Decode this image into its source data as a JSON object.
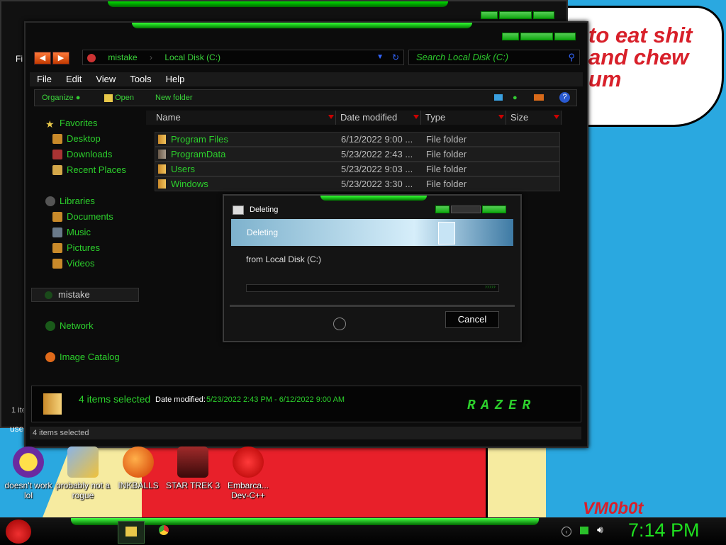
{
  "desktop": {
    "bubble_lines": [
      "to eat shit",
      "and chew",
      "um"
    ],
    "vm_label": "VM0b0t"
  },
  "back_window": {
    "menu_fragment": "Fi",
    "status_fragment": "1 ite",
    "desktop_fragment": "use"
  },
  "explorer": {
    "address": {
      "segments": [
        "mistake",
        "Local Disk (C:)"
      ]
    },
    "search": {
      "placeholder": "Search Local Disk (C:)"
    },
    "menu": [
      "File",
      "Edit",
      "View",
      "Tools",
      "Help"
    ],
    "toolbar": {
      "organize": "Organize",
      "open": "Open",
      "new_folder": "New folder"
    },
    "sidebar": {
      "favorites": "Favorites",
      "favorites_items": [
        "Desktop",
        "Downloads",
        "Recent Places"
      ],
      "libraries": "Libraries",
      "libraries_items": [
        "Documents",
        "Music",
        "Pictures",
        "Videos"
      ],
      "homegroup": "mistake",
      "network": "Network",
      "image_catalog": "Image Catalog"
    },
    "columns": [
      "Name",
      "Date modified",
      "Type",
      "Size"
    ],
    "files": [
      {
        "name": "Program Files",
        "date": "6/12/2022 9:00 ...",
        "type": "File folder"
      },
      {
        "name": "ProgramData",
        "date": "5/23/2022 2:43 ...",
        "type": "File folder"
      },
      {
        "name": "Users",
        "date": "5/23/2022 9:03 ...",
        "type": "File folder"
      },
      {
        "name": "Windows",
        "date": "5/23/2022 3:30 ...",
        "type": "File folder"
      }
    ],
    "details": {
      "selected": "4 items selected",
      "date_label": "Date modified:",
      "date_range": "5/23/2022 2:43 PM - 6/12/2022 9:00 AM",
      "brand": "Razer"
    },
    "status": "4 items selected"
  },
  "dialog": {
    "title": "Deleting",
    "banner": "Deleting",
    "from": "from Local Disk (C:)",
    "cancel": "Cancel"
  },
  "desktop_icons": [
    {
      "label": "doesn't work lol"
    },
    {
      "label": "probably not a rogue"
    },
    {
      "label": "INKBALLS"
    },
    {
      "label": "STAR TREK 3"
    },
    {
      "label": "Embarca... Dev-C++"
    }
  ],
  "taskbar": {
    "clock": "7:14 PM"
  },
  "colors": {
    "accent": "#2cd02c",
    "clock": "#1fe01f",
    "bubble_text": "#d8202a"
  }
}
